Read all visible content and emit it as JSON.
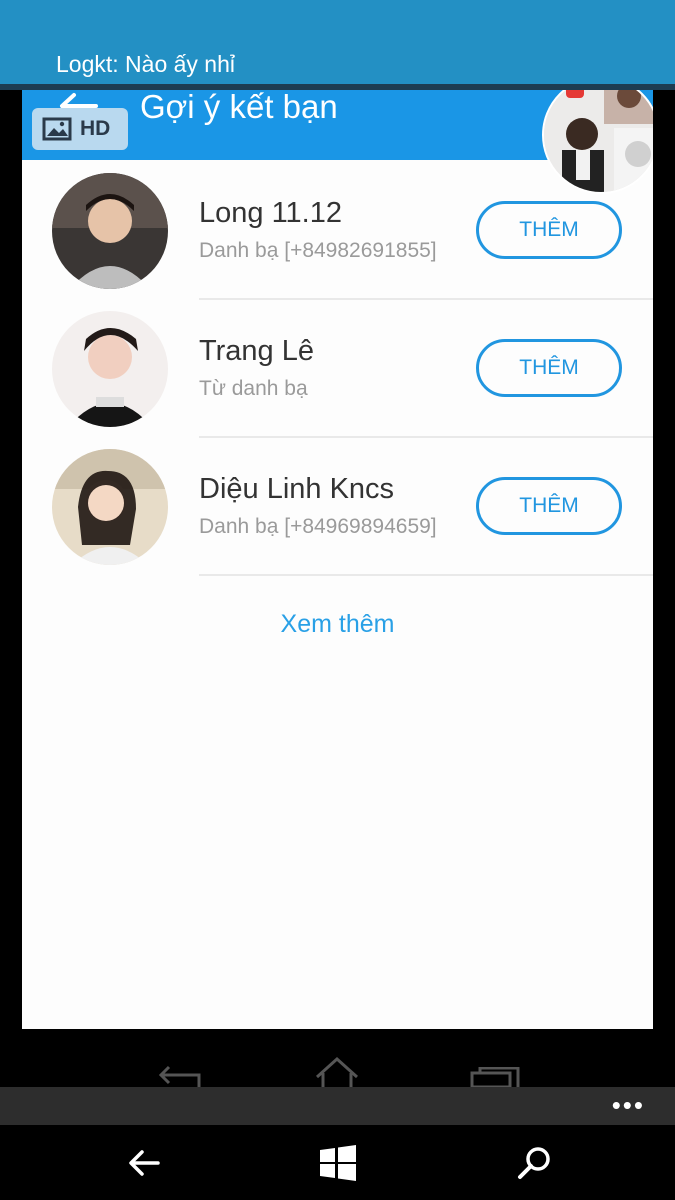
{
  "header": {
    "title": "Logkt: Nào ấy nhỉ"
  },
  "photo": {
    "appbar_title": "Gợi ý kết bạn",
    "hd_label": "HD",
    "suggestions": [
      {
        "name": "Long 11.12",
        "subtitle": "Danh bạ [+84982691855]",
        "button": "THÊM"
      },
      {
        "name": "Trang Lê",
        "subtitle": "Từ danh bạ",
        "button": "THÊM"
      },
      {
        "name": "Diệu Linh Kncs",
        "subtitle": "Danh bạ [+84969894659]",
        "button": "THÊM"
      }
    ],
    "see_more": "Xem thêm"
  },
  "appbar": {
    "more": "•••"
  },
  "colors": {
    "accent": "#2390c4",
    "app_blue": "#1a96e6",
    "button_blue": "#2196e0"
  }
}
